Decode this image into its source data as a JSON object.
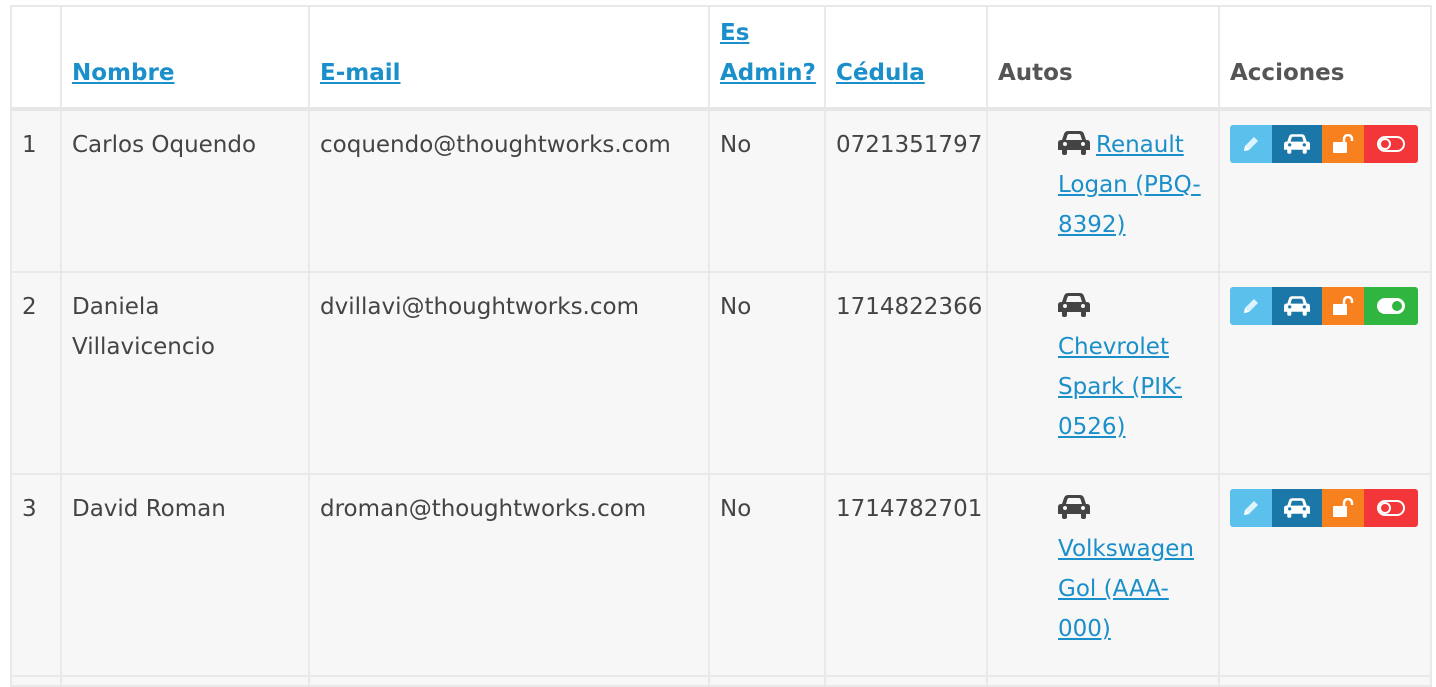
{
  "table": {
    "headers": {
      "index": "",
      "nombre": "Nombre",
      "email": "E-mail",
      "es_admin_line1": "Es",
      "es_admin_line2": "Admin?",
      "cedula": "Cédula",
      "autos": "Autos",
      "acciones": "Acciones"
    },
    "rows": [
      {
        "index": "1",
        "nombre": "Carlos Oquendo",
        "email": "coquendo@thoughtworks.com",
        "admin": "No",
        "cedula": "0721351797",
        "auto": "Renault Logan (PBQ-8392)",
        "active": false
      },
      {
        "index": "2",
        "nombre": "Daniela Villavicencio",
        "email": "dvillavi@thoughtworks.com",
        "admin": "No",
        "cedula": "1714822366",
        "auto": "Chevrolet Spark (PIK-0526)",
        "active": true
      },
      {
        "index": "3",
        "nombre": "David Roman",
        "email": "droman@thoughtworks.com",
        "admin": "No",
        "cedula": "1714782701",
        "auto": "Volkswagen Gol (AAA-000)",
        "active": false
      }
    ]
  },
  "icons": {
    "auto": "car-icon",
    "edit": "pencil-icon",
    "cars": "car-icon",
    "permissions": "unlock-icon",
    "status_off": "toggle-off-icon",
    "status_on": "toggle-on-icon"
  },
  "colors": {
    "link": "#1a8fc9",
    "edit": "#5bc0eb",
    "cars": "#1b77a8",
    "lock": "#f7811f",
    "toggle_off": "#f2363a",
    "toggle_on": "#2fb540"
  }
}
